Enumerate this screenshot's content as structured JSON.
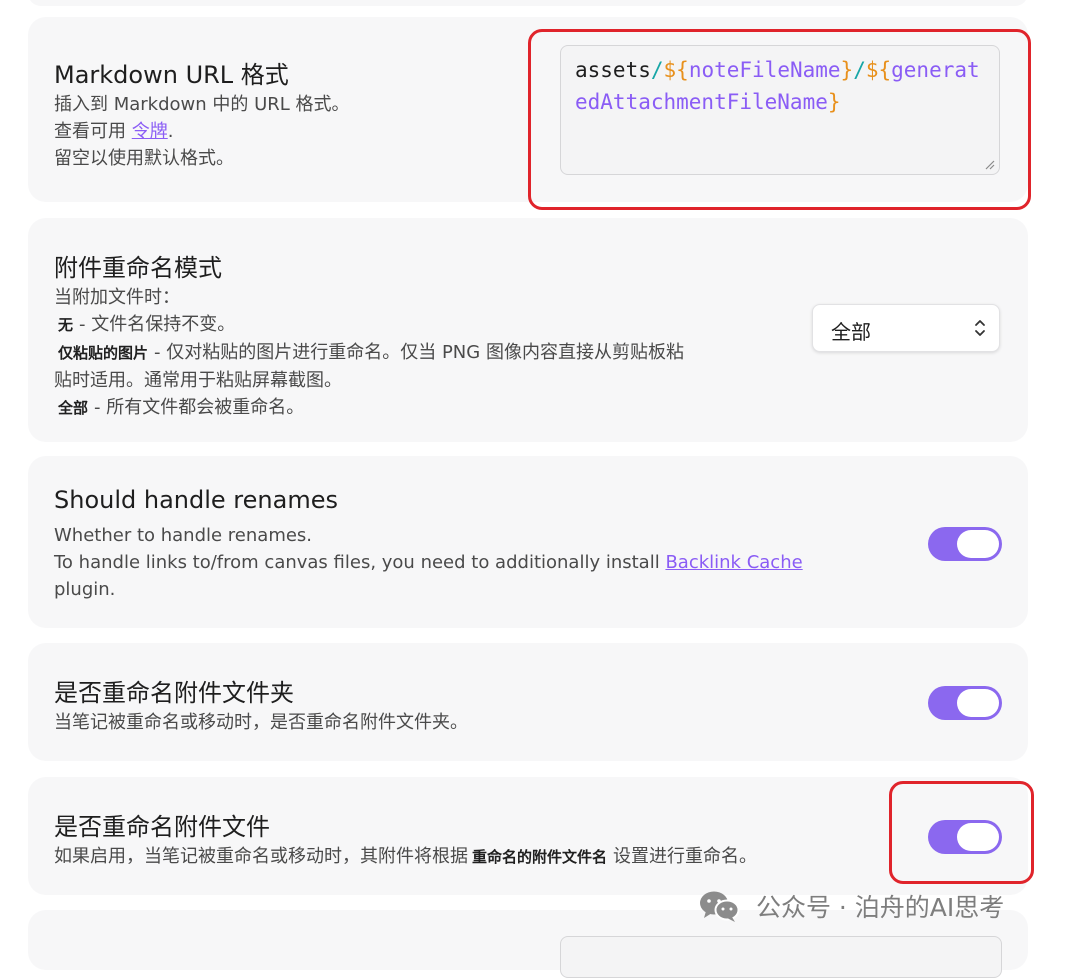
{
  "sections": {
    "url_format": {
      "title": "Markdown URL 格式",
      "desc_line1": "插入到 Markdown 中的 URL 格式。",
      "desc_line2_prefix": "查看可用 ",
      "desc_link": "令牌",
      "desc_line2_suffix": ".",
      "desc_line3": "留空以使用默认格式。",
      "value_parts": {
        "p1": "assets",
        "p2": "/",
        "p3": "${",
        "p4": "noteFileName",
        "p5": "}",
        "p6": "/",
        "p7": "${",
        "p8": "generatedAttachmentFileName",
        "p9": "}"
      }
    },
    "rename_mode": {
      "title": "附件重命名模式",
      "desc_line1": "当附加文件时：",
      "opt_none_label": "无",
      "opt_none_desc": "- 文件名保持不变。",
      "opt_paste_label": "仅粘贴的图片",
      "opt_paste_desc": "- 仅对粘贴的图片进行重命名。仅当 PNG 图像内容直接从剪贴板粘",
      "opt_paste_desc2": "贴时适用。通常用于粘贴屏幕截图。",
      "opt_all_label": "全部",
      "opt_all_desc": "- 所有文件都会被重命名。",
      "selected": "全部"
    },
    "handle_renames": {
      "title": "Should handle renames",
      "desc_line1": "Whether to handle renames.",
      "desc_line2_prefix": "To handle links to/from canvas files, you need to additionally install ",
      "desc_link": "Backlink Cache",
      "desc_line3": "plugin.",
      "enabled": true
    },
    "rename_folder": {
      "title": "是否重命名附件文件夹",
      "desc_line1": "当笔记被重命名或移动时，是否重命名附件文件夹。",
      "enabled": true
    },
    "rename_files": {
      "title": "是否重命名附件文件",
      "desc_prefix": "如果启用，当笔记被重命名或移动时，其附件将根据",
      "desc_kw": "重命名的附件文件名",
      "desc_suffix": "设置进行重命名。",
      "enabled": true
    }
  },
  "watermark": {
    "text": "公众号 · 泊舟的AI思考",
    "icon": "wechat-icon"
  },
  "colors": {
    "accent": "#8b68ef",
    "highlight": "#e0242b"
  }
}
